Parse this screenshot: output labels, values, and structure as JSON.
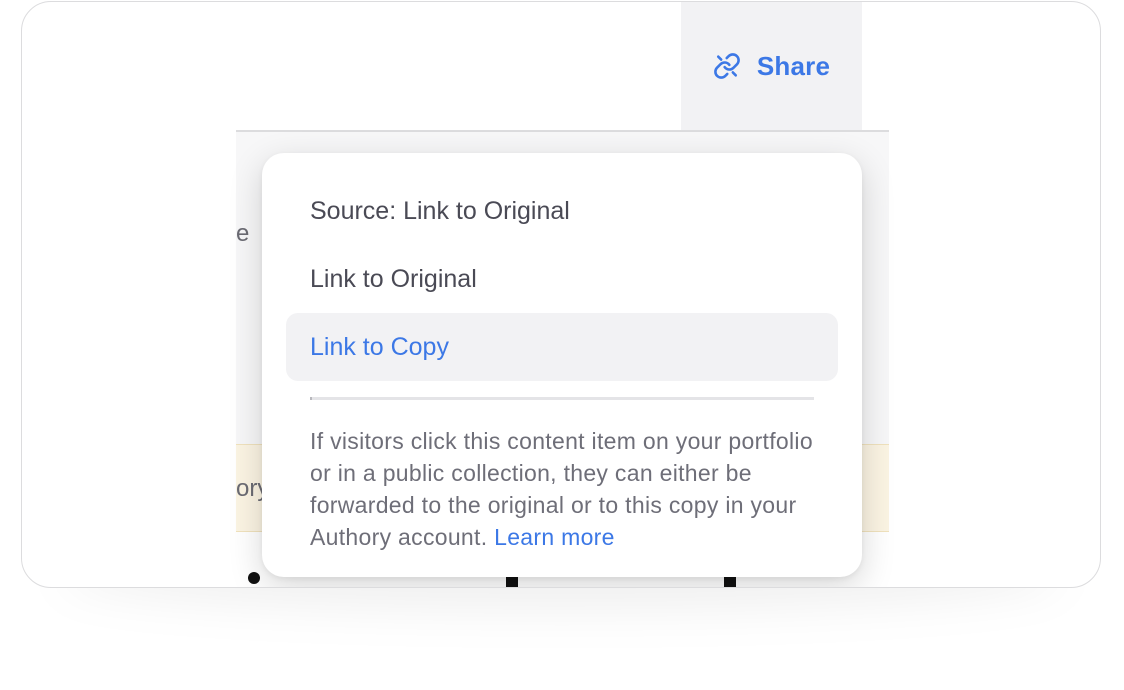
{
  "share": {
    "label": "Share",
    "icon": "link-icon",
    "accent_color": "#3c78e6"
  },
  "background": {
    "fragment_1": "e",
    "fragment_2": "ory"
  },
  "share_menu": {
    "items": [
      {
        "label": "Source: Link to Original",
        "selected": false
      },
      {
        "label": "Link to Original",
        "selected": false
      },
      {
        "label": "Link to Copy",
        "selected": true
      }
    ],
    "description": "If visitors click this content item on your portfolio or in a public collection, they can either be forwarded to the original or to this copy in your Authory account.",
    "learn_more": "Learn more"
  }
}
